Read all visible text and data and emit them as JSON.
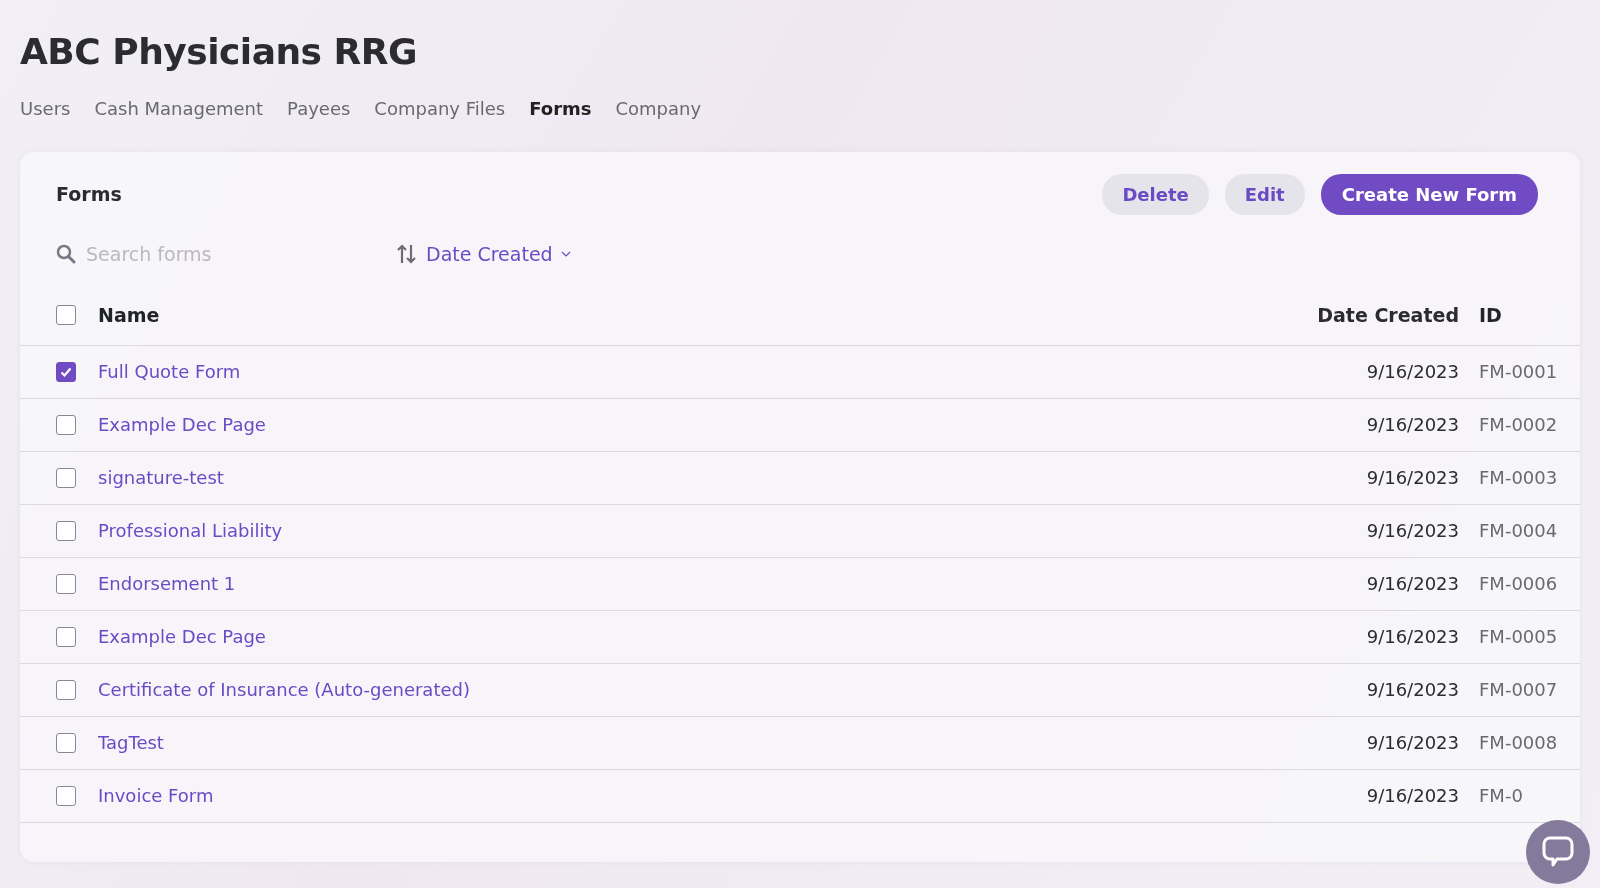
{
  "title": "ABC Physicians RRG",
  "tabs": [
    {
      "label": "Users",
      "selected": false
    },
    {
      "label": "Cash Management",
      "selected": false
    },
    {
      "label": "Payees",
      "selected": false
    },
    {
      "label": "Company Files",
      "selected": false
    },
    {
      "label": "Forms",
      "selected": true
    },
    {
      "label": "Company",
      "selected": false
    }
  ],
  "panel": {
    "title": "Forms",
    "buttons": [
      {
        "label": "Delete",
        "kind": "secondary"
      },
      {
        "label": "Edit",
        "kind": "secondary"
      },
      {
        "label": "Create New Form",
        "kind": "primary"
      }
    ],
    "search": {
      "placeholder": "Search forms"
    },
    "sort": {
      "label": "Date Created"
    }
  },
  "table": {
    "columns": [
      "Name",
      "Date Created",
      "ID"
    ],
    "all_checked": false,
    "rows": [
      {
        "name": "Full Quote Form",
        "date": "9/16/2023",
        "id": "FM-0001",
        "checked": true
      },
      {
        "name": "Example Dec Page",
        "date": "9/16/2023",
        "id": "FM-0002",
        "checked": false
      },
      {
        "name": "signature-test",
        "date": "9/16/2023",
        "id": "FM-0003",
        "checked": false
      },
      {
        "name": "Professional Liability",
        "date": "9/16/2023",
        "id": "FM-0004",
        "checked": false
      },
      {
        "name": "Endorsement 1",
        "date": "9/16/2023",
        "id": "FM-0006",
        "checked": false
      },
      {
        "name": "Example Dec Page",
        "date": "9/16/2023",
        "id": "FM-0005",
        "checked": false
      },
      {
        "name": "Certificate of Insurance (Auto-generated)",
        "date": "9/16/2023",
        "id": "FM-0007",
        "checked": false
      },
      {
        "name": "TagTest",
        "date": "9/16/2023",
        "id": "FM-0008",
        "checked": false
      },
      {
        "name": "Invoice Form",
        "date": "9/16/2023",
        "id": "FM-0",
        "checked": false
      }
    ]
  }
}
